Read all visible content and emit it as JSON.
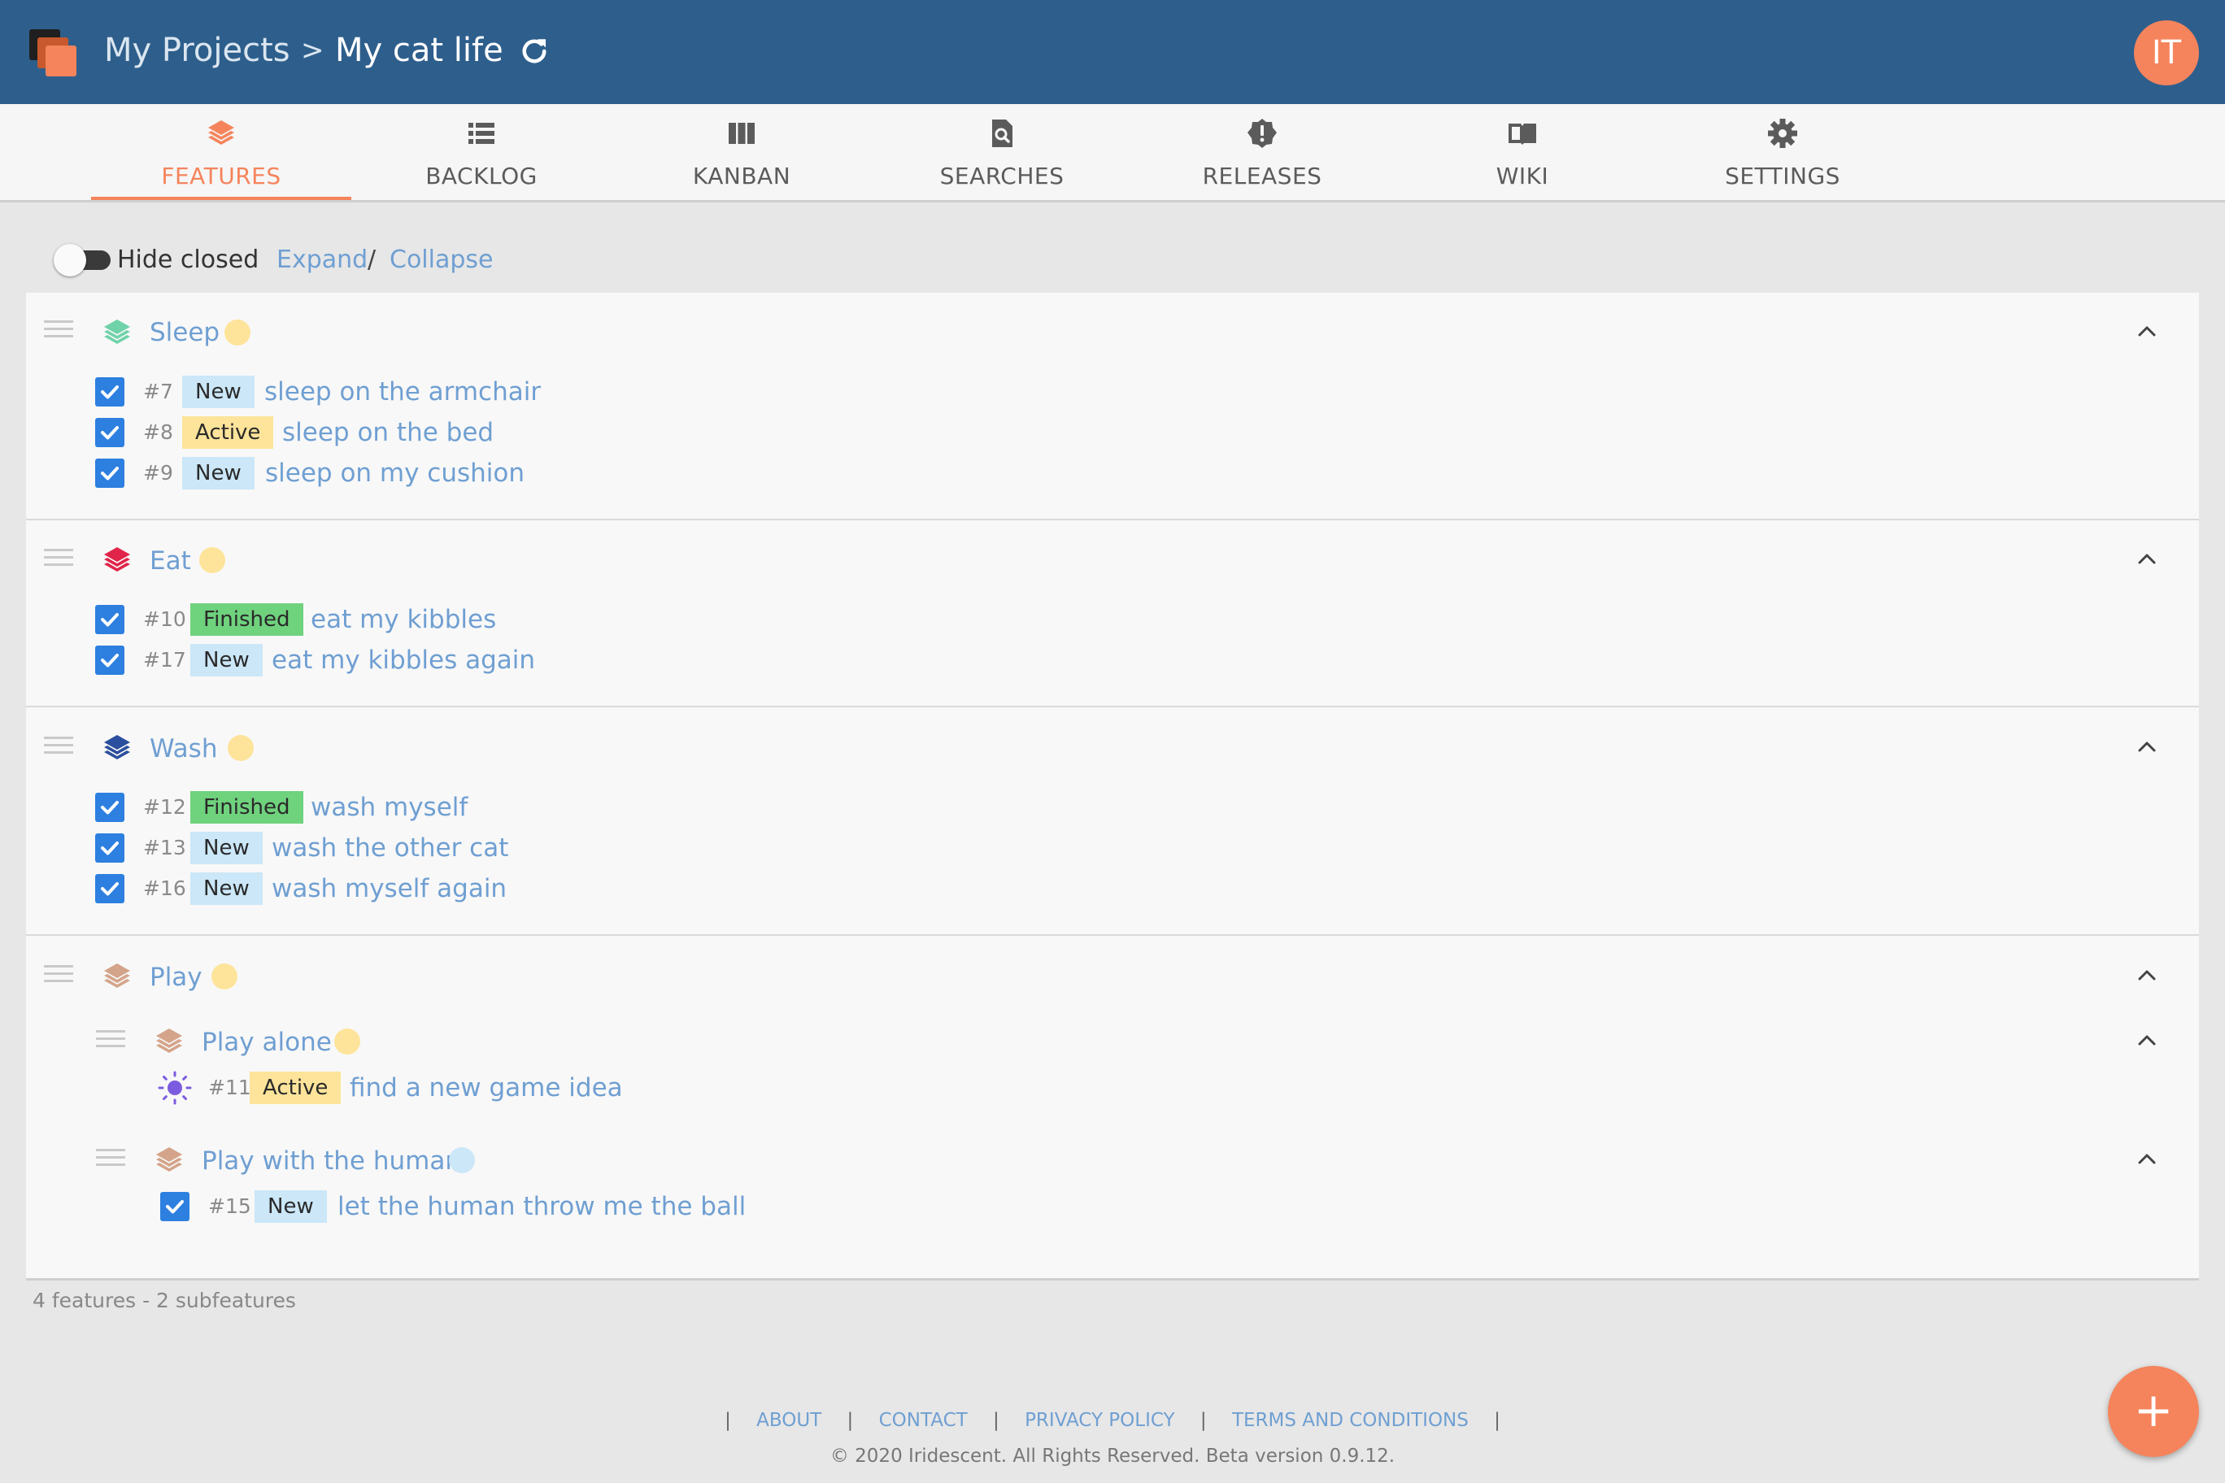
{
  "header": {
    "breadcrumb_root": "My Projects",
    "breadcrumb_separator": ">",
    "project_name": "My cat life",
    "avatar_initials": "IT"
  },
  "tabs": [
    {
      "label": "FEATURES",
      "icon": "layers-icon",
      "active": true
    },
    {
      "label": "BACKLOG",
      "icon": "list-icon",
      "active": false
    },
    {
      "label": "KANBAN",
      "icon": "kanban-icon",
      "active": false
    },
    {
      "label": "SEARCHES",
      "icon": "search-document-icon",
      "active": false
    },
    {
      "label": "RELEASES",
      "icon": "alert-badge-icon",
      "active": false
    },
    {
      "label": "WIKI",
      "icon": "book-icon",
      "active": false
    },
    {
      "label": "SETTINGS",
      "icon": "gear-icon",
      "active": false
    }
  ],
  "toolbar": {
    "hide_closed_label": "Hide closed",
    "expand_label": "Expand",
    "slash": "/",
    "collapse_label": "Collapse"
  },
  "features": [
    {
      "name": "Sleep",
      "color": "#6fd2a8",
      "dot_color": "#fde49a",
      "items": [
        {
          "number": "#7",
          "status": "New",
          "title": "sleep on the armchair"
        },
        {
          "number": "#8",
          "status": "Active",
          "title": "sleep on the bed"
        },
        {
          "number": "#9",
          "status": "New",
          "title": "sleep on my cushion"
        }
      ]
    },
    {
      "name": "Eat",
      "color": "#e0244a",
      "dot_color": "#fde49a",
      "items": [
        {
          "number": "#10",
          "status": "Finished",
          "title": "eat my kibbles"
        },
        {
          "number": "#17",
          "status": "New",
          "title": "eat my kibbles again"
        }
      ]
    },
    {
      "name": "Wash",
      "color": "#2b4f9e",
      "dot_color": "#fde49a",
      "items": [
        {
          "number": "#12",
          "status": "Finished",
          "title": "wash myself"
        },
        {
          "number": "#13",
          "status": "New",
          "title": "wash the other cat"
        },
        {
          "number": "#16",
          "status": "New",
          "title": "wash myself again"
        }
      ]
    },
    {
      "name": "Play",
      "color": "#d4a48a",
      "dot_color": "#fde49a",
      "subfeatures": [
        {
          "name": "Play alone",
          "color": "#d4a48a",
          "dot_color": "#fde49a",
          "items": [
            {
              "number": "#11",
              "status": "Active",
              "title": "find a new game idea",
              "icon": "sun-icon"
            }
          ]
        },
        {
          "name": "Play with the human",
          "color": "#d4a48a",
          "dot_color": "#cbe7f8",
          "items": [
            {
              "number": "#15",
              "status": "New",
              "title": "let the human throw me the ball"
            }
          ]
        }
      ]
    }
  ],
  "summary": "4 features - 2 subfeatures",
  "footer": {
    "links": [
      "ABOUT",
      "CONTACT",
      "PRIVACY POLICY",
      "TERMS AND CONDITIONS"
    ],
    "separator": "|",
    "copyright": "© 2020 Iridescent. All Rights Reserved. Beta version 0.9.12."
  },
  "fab_label": "+",
  "colors": {
    "header_bg": "#2e5f8c",
    "accent": "#f5845c",
    "link": "#6f9fd2",
    "checkbox": "#2d7fe0",
    "sun_icon": "#7b5be0",
    "badge_new": "#cbe7f8",
    "badge_active": "#fde49a",
    "badge_finished": "#6fd27d"
  }
}
